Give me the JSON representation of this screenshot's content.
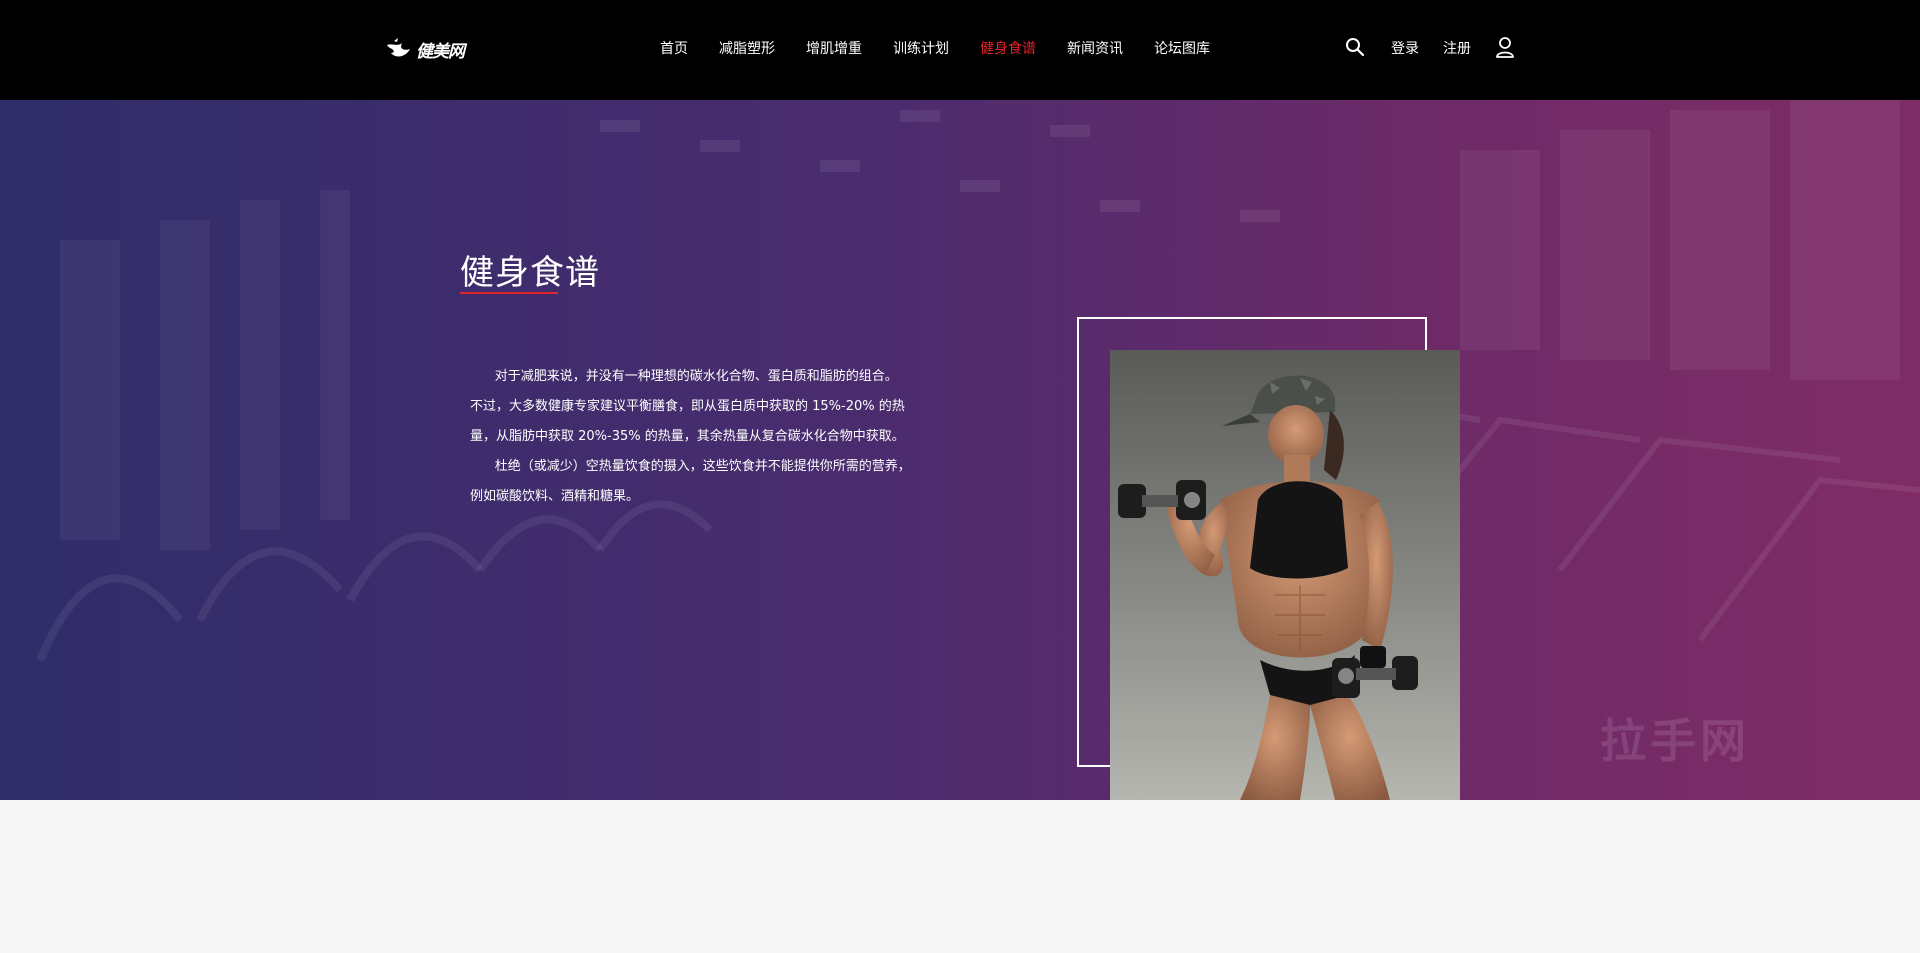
{
  "header": {
    "logo_text": "健美网",
    "nav": [
      {
        "label": "首页",
        "active": false
      },
      {
        "label": "减脂塑形",
        "active": false
      },
      {
        "label": "增肌增重",
        "active": false
      },
      {
        "label": "训练计划",
        "active": false
      },
      {
        "label": "健身食谱",
        "active": true
      },
      {
        "label": "新闻资讯",
        "active": false
      },
      {
        "label": "论坛图库",
        "active": false
      }
    ],
    "login_label": "登录",
    "register_label": "注册",
    "search_icon": "search-icon",
    "user_icon": "user-icon"
  },
  "hero": {
    "title": "健身食谱",
    "paragraphs": [
      "      对于减肥来说，并没有一种理想的碳水化合物、蛋白质和脂肪的组合。",
      "不过，大多数健康专家建议平衡膳食，即从蛋白质中获取的 15%-20% 的热",
      "量，从脂肪中获取 20%-35% 的热量，其余热量从复合碳水化合物中获取。",
      "      杜绝（或减少）空热量饮食的摄入，这些饮食并不能提供你所需的营养，",
      "例如碳酸饮料、酒精和糖果。"
    ],
    "photo_alt": "fitness woman with dumbbells"
  },
  "colors": {
    "accent": "#e0232c",
    "header_bg": "#000000",
    "hero_left": "#302c6e",
    "hero_right": "#842c68"
  }
}
